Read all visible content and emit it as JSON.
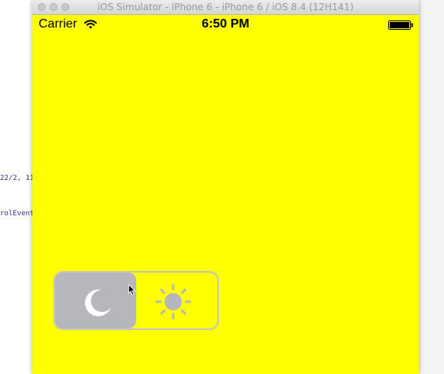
{
  "background_code": {
    "line_a": "22/2, 11",
    "line_b": "rolEvent"
  },
  "window": {
    "title": "iOS Simulator - iPhone 6 - iPhone 6 / iOS 8.4 (12H141)"
  },
  "status_bar": {
    "carrier": "Carrier",
    "time": "6:50 PM",
    "wifi_icon": "wifi-icon",
    "battery_icon": "battery-icon"
  },
  "app": {
    "background_color": "#ffff00",
    "day_night_switch": {
      "state": "night",
      "left_icon": "moon-icon",
      "right_icon": "sun-icon",
      "knob_color": "#b6b7bd",
      "border_color": "#c3c3c8"
    }
  }
}
